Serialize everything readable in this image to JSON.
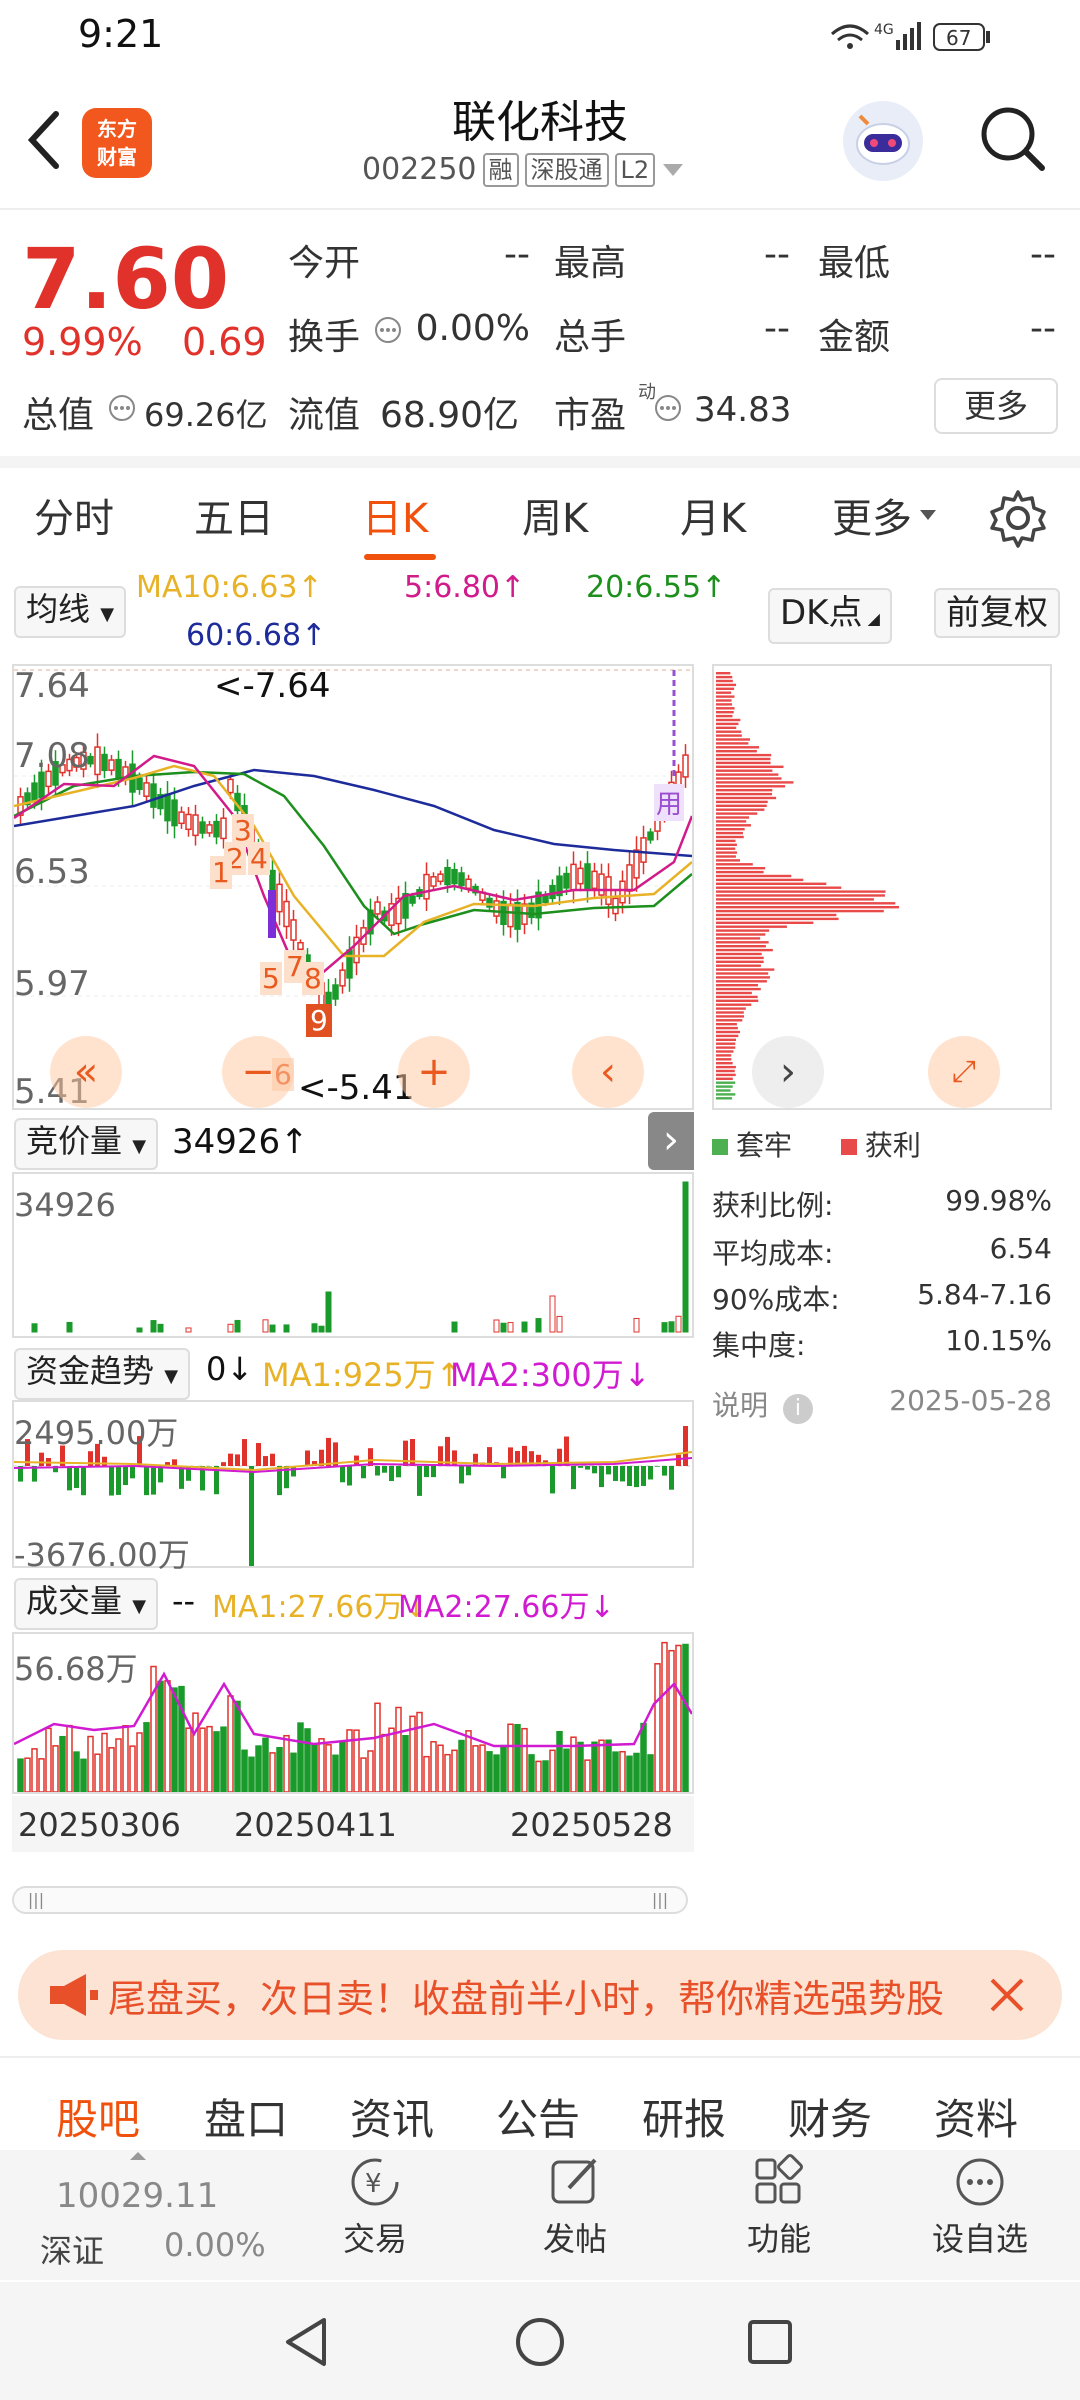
{
  "status": {
    "time": "9:21",
    "network": "4G",
    "battery": "67"
  },
  "header": {
    "brand_line1": "东方",
    "brand_line2": "财富",
    "title": "联化科技",
    "code": "002250",
    "tags": [
      "融",
      "深股通",
      "L2"
    ]
  },
  "quote": {
    "price": "7.60",
    "change_pct": "9.99%",
    "change": "0.69",
    "open_label": "今开",
    "open": "--",
    "high_label": "最高",
    "high": "--",
    "low_label": "最低",
    "low": "--",
    "turnover_label": "换手",
    "turnover": "0.00%",
    "total_hand_label": "总手",
    "total_hand": "--",
    "amount_label": "金额",
    "amount": "--",
    "mktcap_label": "总值",
    "mktcap": "69.26亿",
    "float_label": "流值",
    "float": "68.90亿",
    "pe_label": "市盈",
    "pe_sup": "动",
    "pe": "34.83",
    "more": "更多"
  },
  "tabs": [
    "分时",
    "五日",
    "日K",
    "周K",
    "月K",
    "更多"
  ],
  "active_tab": "日K",
  "indicators": {
    "ma_select": "均线",
    "ma10": "MA10:6.63↑",
    "ma5": "5:6.80↑",
    "ma20": "20:6.55↑",
    "ma60": "60:6.68↑",
    "dk_button": "DK点",
    "fuquan_button": "前复权"
  },
  "kline": {
    "y_labels": [
      "7.64",
      "7.08",
      "6.53",
      "5.97",
      "5.41"
    ],
    "high_annot": "<-7.64",
    "low_annot": "<-5.41",
    "markers": [
      "3",
      "2",
      "4",
      "1",
      "5",
      "7",
      "8",
      "9",
      "6"
    ],
    "side_tag": "用"
  },
  "auction": {
    "label": "竞价量",
    "value": "34926↑",
    "y_max": "34926"
  },
  "capital": {
    "label": "资金趋势",
    "value": "0↓",
    "ma1": "MA1:925万↑",
    "ma2": "MA2:300万↓",
    "y_max": "2495.00万",
    "y_min": "-3676.00万"
  },
  "volume": {
    "label": "成交量",
    "value": "--",
    "ma1": "MA1:27.66万↓",
    "ma2": "MA2:27.66万↓",
    "y_max": "56.68万"
  },
  "dates": [
    "20250306",
    "20250411",
    "20250528"
  ],
  "chip": {
    "legend_trapped": "套牢",
    "legend_profit": "获利",
    "rows": [
      {
        "label": "获利比例:",
        "value": "99.98%"
      },
      {
        "label": "平均成本:",
        "value": "6.54"
      },
      {
        "label": "90%成本:",
        "value": "5.84-7.16"
      },
      {
        "label": "集中度:",
        "value": "10.15%"
      }
    ],
    "note_label": "说明",
    "date": "2025-05-28"
  },
  "banner": {
    "text": "尾盘买，次日卖！收盘前半小时，帮你精选强势股"
  },
  "bottom_tabs": [
    "股吧",
    "盘口",
    "资讯",
    "公告",
    "研报",
    "财务",
    "资料"
  ],
  "bottom_nav": {
    "index_value": "10029.11",
    "index_name": "深证",
    "index_change": "0.00%",
    "items": [
      "交易",
      "发帖",
      "功能",
      "设自选"
    ]
  },
  "colors": {
    "accent": "#f0520d",
    "up": "#e0322b",
    "down": "#1a9a2a",
    "ma5": "#d11b8a",
    "ma10": "#e8b227",
    "ma20": "#1d8f1d",
    "ma60": "#1d2c9a"
  }
}
